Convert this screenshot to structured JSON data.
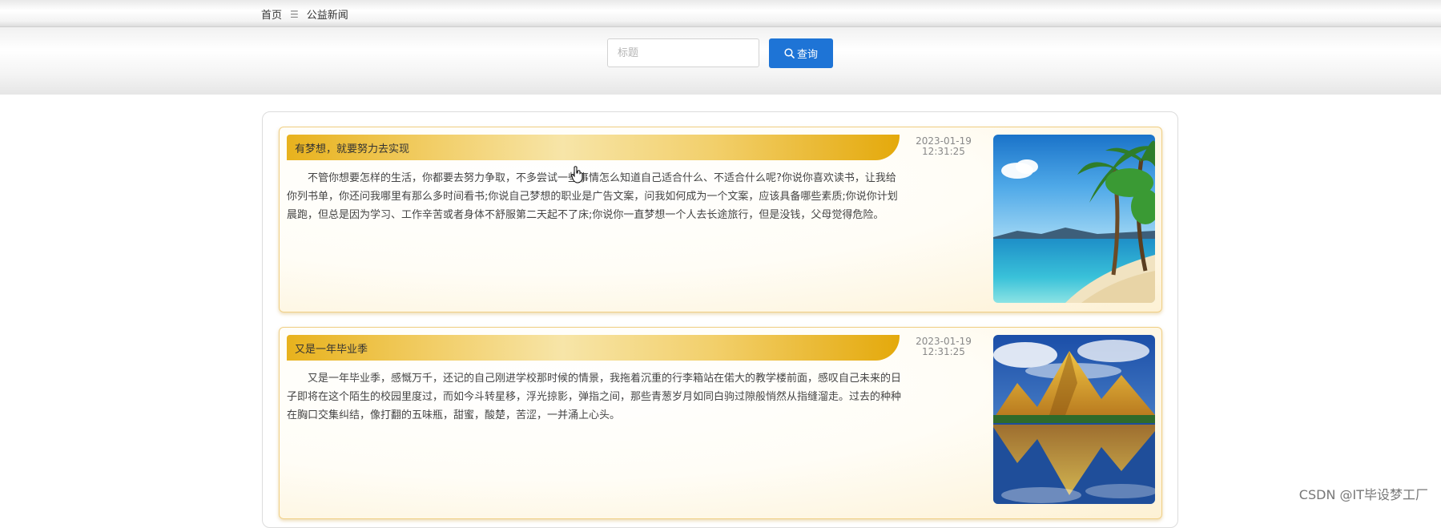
{
  "breadcrumb": {
    "home": "首页",
    "separator": "☰",
    "current": "公益新闻"
  },
  "search": {
    "placeholder": "标题",
    "value": "",
    "button_label": "查询",
    "button_color": "#1e74d6"
  },
  "news": [
    {
      "title": "有梦想，就要努力去实现",
      "date": "2023-01-19",
      "time": "12:31:25",
      "summary": "不管你想要怎样的生活，你都要去努力争取，不多尝试一些事情怎么知道自己适合什么、不适合什么呢?你说你喜欢读书，让我给你列书单，你还问我哪里有那么多时间看书;你说自己梦想的职业是广告文案，问我如何成为一个文案，应该具备哪些素质;你说你计划晨跑，但总是因为学习、工作辛苦或者身体不舒服第二天起不了床;你说你一直梦想一个人去长途旅行，但是没钱，父母觉得危险。",
      "image": "beach-palm-photo"
    },
    {
      "title": "又是一年毕业季",
      "date": "2023-01-19",
      "time": "12:31:25",
      "summary": "又是一年毕业季，感慨万千，还记的自己刚进学校那时候的情景，我拖着沉重的行李箱站在偌大的教学楼前面，感叹自己未来的日子即将在这个陌生的校园里度过，而如今斗转星移，浮光掠影，弹指之间，那些青葱岁月如同白驹过隙般悄然从指缝溜走。过去的种种在胸口交集纠结，像打翻的五味瓶，甜蜜，酸楚，苦涩，一并涌上心头。",
      "image": "mountain-lake-photo"
    }
  ],
  "watermark": "CSDN @IT毕设梦工厂",
  "colors": {
    "ribbon_gold": "#e8b21d",
    "card_border": "#f0cf85"
  }
}
